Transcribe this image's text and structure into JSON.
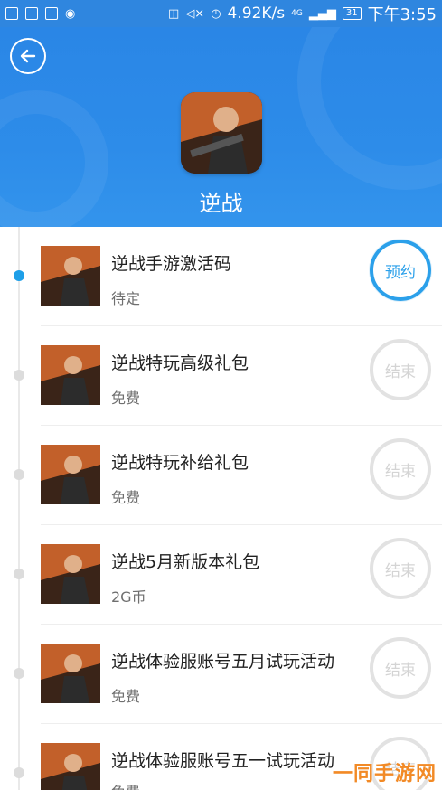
{
  "status_bar": {
    "speed": "4.92K/s",
    "battery": "31",
    "time": "下午3:55",
    "network_label": "4G"
  },
  "header": {
    "title": "逆战",
    "background_color": "#2d8ce9"
  },
  "gifts": [
    {
      "title": "逆战手游激活码",
      "subtitle": "待定",
      "status": "预约",
      "active": true
    },
    {
      "title": "逆战特玩高级礼包",
      "subtitle": "免费",
      "status": "结束",
      "active": false
    },
    {
      "title": "逆战特玩补给礼包",
      "subtitle": "免费",
      "status": "结束",
      "active": false
    },
    {
      "title": "逆战5月新版本礼包",
      "subtitle": "2G币",
      "status": "结束",
      "active": false
    },
    {
      "title": "逆战体验服账号五月试玩活动",
      "subtitle": "免费",
      "status": "结束",
      "active": false
    },
    {
      "title": "逆战体验服账号五一试玩活动",
      "subtitle": "免费",
      "status": "结束",
      "active": false
    }
  ],
  "watermark": "一同手游网",
  "colors": {
    "accent": "#2ba0ea",
    "inactive": "#e2e2e2"
  }
}
